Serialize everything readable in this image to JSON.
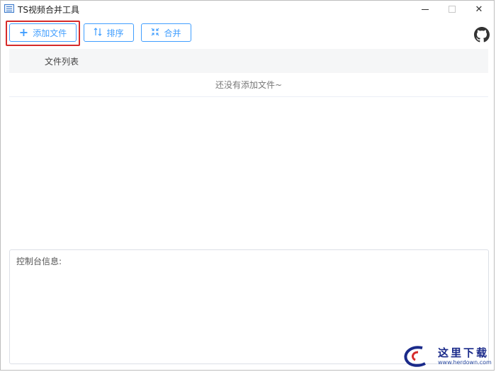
{
  "window": {
    "title": "TS视频合并工具",
    "controls": {
      "minimize": "",
      "maximize": "",
      "close": "✕"
    }
  },
  "toolbar": {
    "add_file_label": "添加文件",
    "sort_label": "排序",
    "merge_label": "合并",
    "add_icon": "plus-icon",
    "sort_icon": "sort-icon",
    "merge_icon": "merge-icon",
    "accent": "#409eff",
    "highlight_color": "#d62b2b"
  },
  "file_list": {
    "column_header": "文件列表",
    "empty_text": "还没有添加文件~"
  },
  "console": {
    "label": "控制台信息:"
  },
  "watermark": {
    "text": "这里下载",
    "url": "www.herdown.com"
  }
}
